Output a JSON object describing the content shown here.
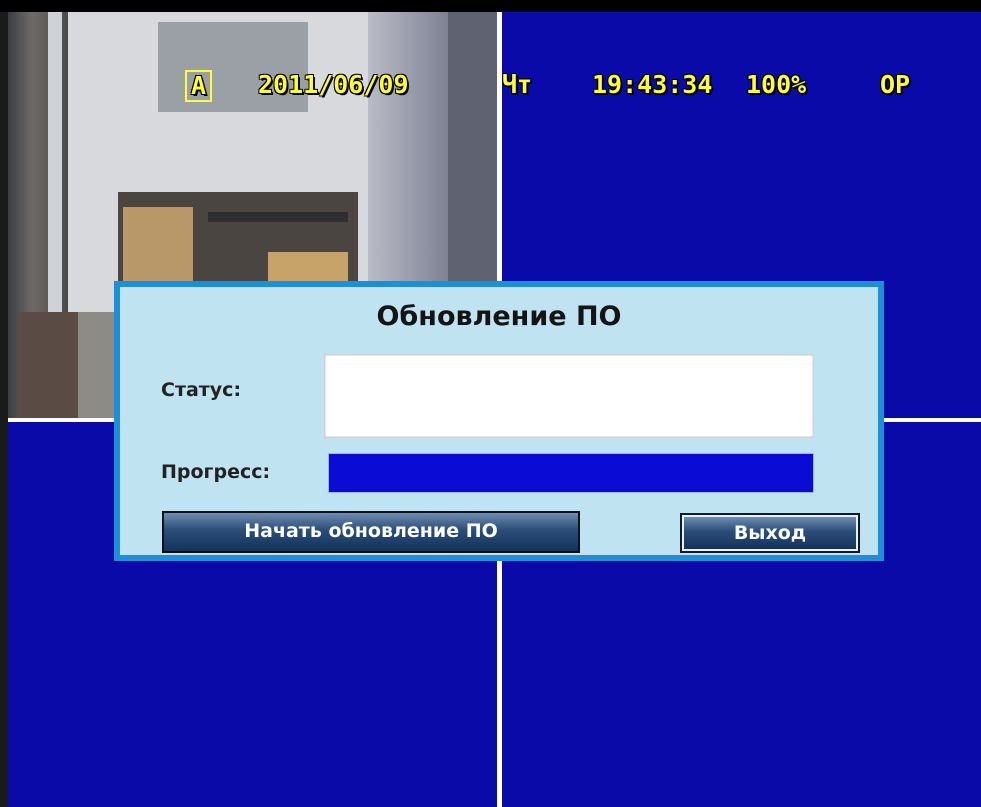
{
  "osd": {
    "channel": "A",
    "date": "2011/06/09",
    "weekday": "Чт",
    "time": "19:43:34",
    "percent": "100%",
    "mode": "OP"
  },
  "dialog": {
    "title": "Обновление ПО",
    "status_label": "Статус:",
    "status_value": "",
    "progress_label": "Прогресс:",
    "progress_fraction": 0,
    "start_button": "Начать обновление ПО",
    "exit_button": "Выход"
  },
  "colors": {
    "screen_blue": "#0a0aa8",
    "osd_yellow": "#ffff33",
    "dialog_border": "#1c8fd8",
    "dialog_bg": "#bfe3f1",
    "progress_bg": "#0b0bd6"
  }
}
